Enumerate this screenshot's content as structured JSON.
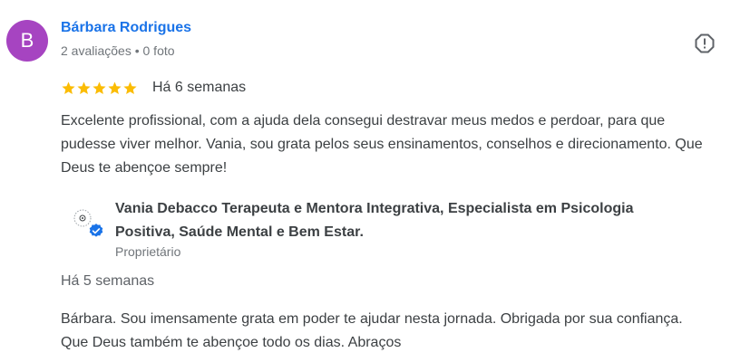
{
  "review": {
    "avatar_letter": "B",
    "avatar_color": "#a644c1",
    "reviewer_name": "Bárbara Rodrigues",
    "reviewer_meta": "2 avaliações • 0 foto",
    "flag_icon": "report-flag-icon",
    "rating": 5,
    "rating_max": 5,
    "star_color": "#fbbc04",
    "date": "Há 6 semanas",
    "text": "Excelente profissional, com a ajuda dela consegui destravar meus medos e perdoar, para que pudesse viver melhor. Vania, sou grata pelos seus ensinamentos, conselhos e direcionamento. Que Deus te abençoe sempre!"
  },
  "owner_reply": {
    "logo_icon": "business-logo-icon",
    "verified_icon": "verified-check-icon",
    "verified_color": "#1a73e8",
    "name": "Vania Debacco Terapeuta e Mentora Integrativa, Especialista em Psicologia Positiva, Saúde Mental e Bem Estar.",
    "role": "Proprietário",
    "date": "Há 5 semanas",
    "text": "Bárbara. Sou imensamente grata em poder te ajudar nesta jornada. Obrigada por sua confiança. Que Deus também te abençoe todo os dias. Abraços"
  }
}
